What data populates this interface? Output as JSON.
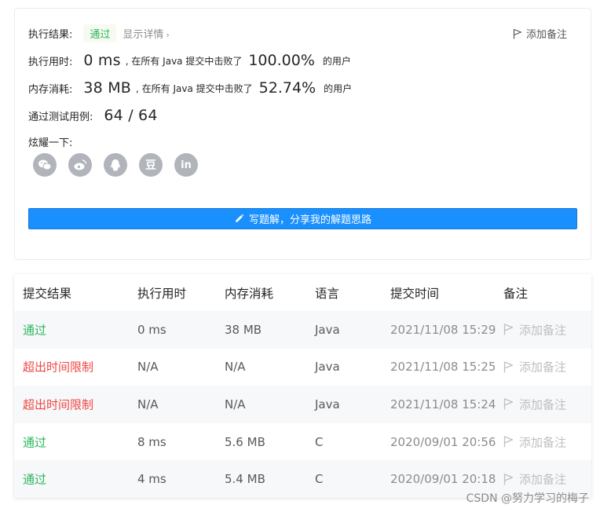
{
  "result": {
    "label_result": "执行结果:",
    "status": "通过",
    "detail_link": "显示详情",
    "add_note": "添加备注",
    "runtime_label": "执行用时:",
    "runtime_value": "0 ms",
    "runtime_middle": ", 在所有 Java 提交中击败了",
    "runtime_pct": "100.00%",
    "runtime_users": "的用户",
    "memory_label": "内存消耗:",
    "memory_value": "38 MB",
    "memory_middle": ", 在所有 Java 提交中击败了",
    "memory_pct": "52.74%",
    "memory_users": "的用户",
    "tests_label": "通过测试用例:",
    "tests_value": "64 / 64",
    "share_label": "炫耀一下:",
    "share_icons": [
      "wechat-icon",
      "weibo-icon",
      "qq-icon",
      "douban-icon",
      "linkedin-icon"
    ],
    "solution_button": "写题解，分享我的解题思路"
  },
  "table": {
    "headers": [
      "提交结果",
      "执行用时",
      "内存消耗",
      "语言",
      "提交时间",
      "备注"
    ],
    "rows": [
      {
        "status": "通过",
        "ok": true,
        "runtime": "0 ms",
        "memory": "38 MB",
        "lang": "Java",
        "time": "2021/11/08 15:29",
        "note": "添加备注"
      },
      {
        "status": "超出时间限制",
        "ok": false,
        "runtime": "N/A",
        "memory": "N/A",
        "lang": "Java",
        "time": "2021/11/08 15:25",
        "note": "添加备注"
      },
      {
        "status": "超出时间限制",
        "ok": false,
        "runtime": "N/A",
        "memory": "N/A",
        "lang": "Java",
        "time": "2021/11/08 15:24",
        "note": "添加备注"
      },
      {
        "status": "通过",
        "ok": true,
        "runtime": "8 ms",
        "memory": "5.6 MB",
        "lang": "C",
        "time": "2020/09/01 20:56",
        "note": "添加备注"
      },
      {
        "status": "通过",
        "ok": true,
        "runtime": "4 ms",
        "memory": "5.4 MB",
        "lang": "C",
        "time": "2020/09/01 20:18",
        "note": "添加备注"
      }
    ]
  },
  "watermark": "CSDN @努力学习的梅子",
  "colors": {
    "pass": "#2db55d",
    "fail": "#ef4743",
    "primary": "#1a90ff",
    "icon_gray": "#b1b5bb"
  }
}
